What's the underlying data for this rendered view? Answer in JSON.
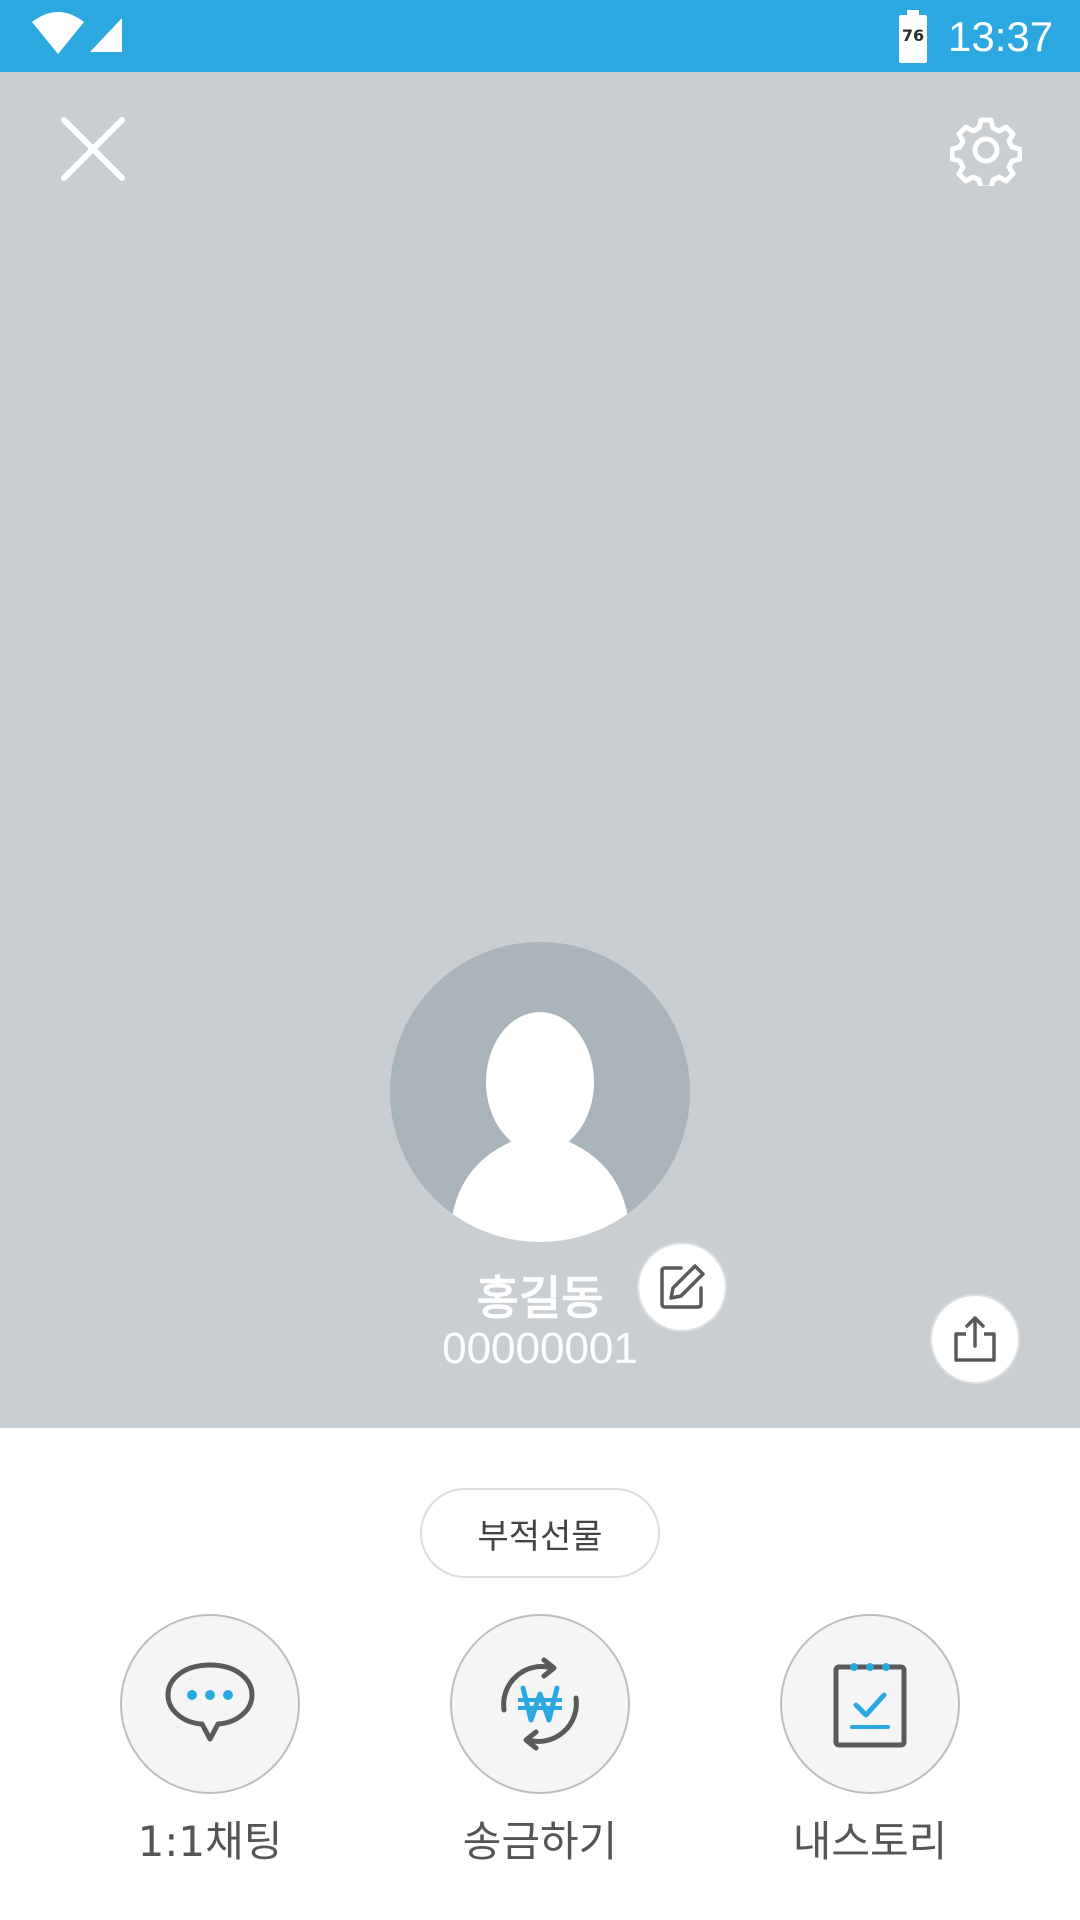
{
  "status_bar": {
    "battery_level": "76",
    "time": "13:37",
    "icons": [
      "wifi-icon",
      "signal-icon",
      "battery-icon"
    ]
  },
  "header": {
    "icons": [
      "close-icon",
      "gear-icon"
    ]
  },
  "profile": {
    "name": "홍길동",
    "id": "00000001",
    "icons": [
      "default-avatar-icon",
      "edit-icon",
      "share-icon"
    ]
  },
  "gift_button": {
    "label": "부적선물"
  },
  "actions": [
    {
      "label": "1:1채팅",
      "icon": "chat-bubble-icon"
    },
    {
      "label": "송금하기",
      "icon": "won-transfer-icon"
    },
    {
      "label": "내스토리",
      "icon": "story-notebook-icon"
    }
  ],
  "colors": {
    "status_bar": "#2ca8e1",
    "profile_background": "#c9ced2",
    "avatar_background": "#a9b3ba",
    "accent": "#2ca8e1",
    "icon_gray": "#5a5a5a"
  }
}
